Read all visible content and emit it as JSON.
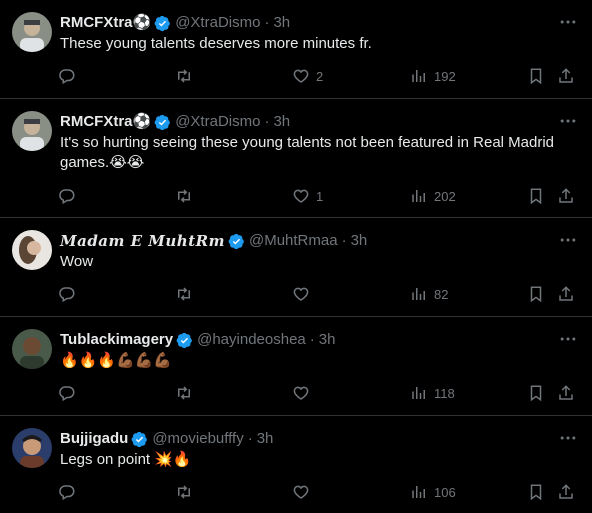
{
  "tweets": [
    {
      "name": "RMCFXtra",
      "name_suffix": "⚽",
      "handle": "@XtraDismo",
      "time": "3h",
      "text": "These young talents deserves more minutes fr.",
      "replies": "",
      "retweets": "",
      "likes": "2",
      "views": "192"
    },
    {
      "name": "RMCFXtra",
      "name_suffix": "⚽",
      "handle": "@XtraDismo",
      "time": "3h",
      "text": "It's so hurting seeing these young talents not been featured in Real Madrid games.😭😭",
      "replies": "",
      "retweets": "",
      "likes": "1",
      "views": "202"
    },
    {
      "name": "Madam E MuhtRm",
      "name_suffix": "",
      "handle": "@MuhtRmaa",
      "time": "3h",
      "text": "Wow",
      "replies": "",
      "retweets": "",
      "likes": "",
      "views": "82"
    },
    {
      "name": "Tublackimagery",
      "name_suffix": "",
      "handle": "@hayindeoshea",
      "time": "3h",
      "text": "🔥🔥🔥💪🏾💪🏾💪🏾",
      "replies": "",
      "retweets": "",
      "likes": "",
      "views": "118"
    },
    {
      "name": "Bujjigadu",
      "name_suffix": "",
      "handle": "@moviebufffy",
      "time": "3h",
      "text": "Legs on point 💥🔥",
      "replies": "",
      "retweets": "",
      "likes": "",
      "views": "106"
    }
  ],
  "colors": {
    "background": "#000000",
    "text": "#e7e9ea",
    "muted": "#71767b",
    "divider": "#2f3336",
    "verified": "#1d9bf0"
  },
  "icons": [
    "verified-badge-icon",
    "more-icon",
    "reply-icon",
    "retweet-icon",
    "like-icon",
    "views-icon",
    "bookmark-icon",
    "share-icon"
  ]
}
